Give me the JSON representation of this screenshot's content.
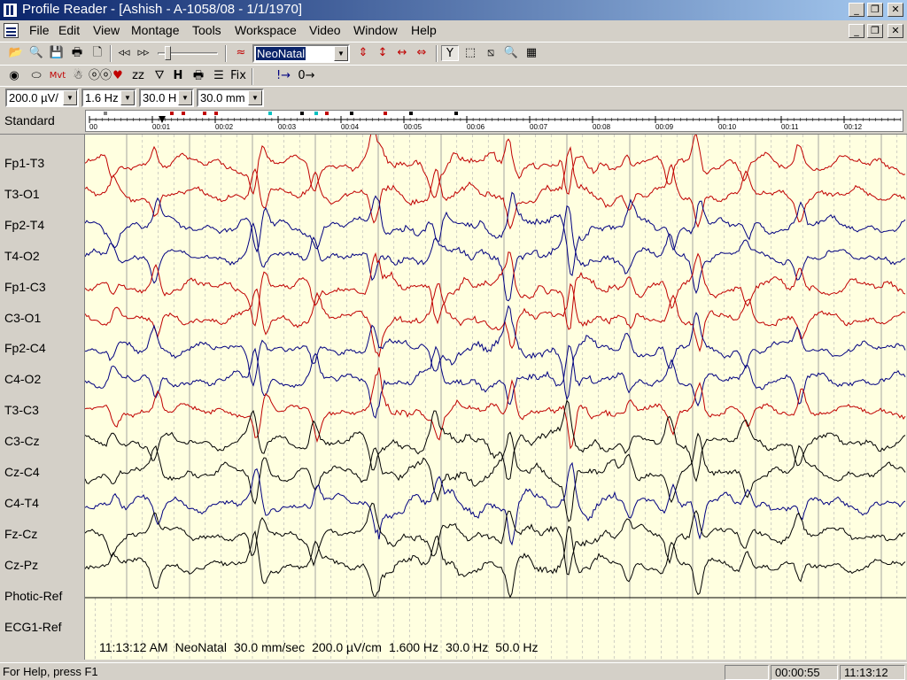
{
  "window": {
    "title": "Profile Reader - [Ashish - A-1058/08 - 1/1/1970]"
  },
  "menu": {
    "items": [
      "File",
      "Edit",
      "View",
      "Montage",
      "Tools",
      "Workspace",
      "Video",
      "Window",
      "Help"
    ]
  },
  "toolbar": {
    "montage_select": "NeoNatal",
    "fix_label": "Fix",
    "h_label": "H"
  },
  "settings": {
    "sensitivity": "200.0 µV/",
    "low_filter": "1.6 Hz",
    "high_filter": "30.0 H",
    "paper_speed": "30.0 mm"
  },
  "montage": {
    "name": "Standard",
    "ruler_ticks": [
      "00",
      "00:01",
      "00:02",
      "00:03",
      "00:04",
      "00:05",
      "00:06",
      "00:07",
      "00:08",
      "00:09",
      "00:10",
      "00:11",
      "00:12"
    ]
  },
  "channels": [
    {
      "label": "Fp1-T3",
      "color": "#c00000"
    },
    {
      "label": "T3-O1",
      "color": "#c00000"
    },
    {
      "label": "Fp2-T4",
      "color": "#000080"
    },
    {
      "label": "T4-O2",
      "color": "#000080"
    },
    {
      "label": "Fp1-C3",
      "color": "#c00000"
    },
    {
      "label": "C3-O1",
      "color": "#c00000"
    },
    {
      "label": "Fp2-C4",
      "color": "#000080"
    },
    {
      "label": "C4-O2",
      "color": "#000080"
    },
    {
      "label": "T3-C3",
      "color": "#c00000"
    },
    {
      "label": "C3-Cz",
      "color": "#000000"
    },
    {
      "label": "Cz-C4",
      "color": "#000000"
    },
    {
      "label": "C4-T4",
      "color": "#000080"
    },
    {
      "label": "Fz-Cz",
      "color": "#000000"
    },
    {
      "label": "Cz-Pz",
      "color": "#000000"
    },
    {
      "label": "Photic-Ref",
      "color": "#000000"
    },
    {
      "label": "ECG1-Ref",
      "color": "#000000"
    }
  ],
  "info": {
    "time": "11:13:12 AM",
    "montage": "NeoNatal",
    "speed": "30.0 mm/sec",
    "sensitivity": "200.0 µV/cm",
    "low_filter": "1.600 Hz",
    "high_filter": "30.0 Hz",
    "notch": "50.0 Hz"
  },
  "status": {
    "help": "For Help, press F1",
    "elapsed": "00:00:55",
    "clock": "11:13:12"
  }
}
